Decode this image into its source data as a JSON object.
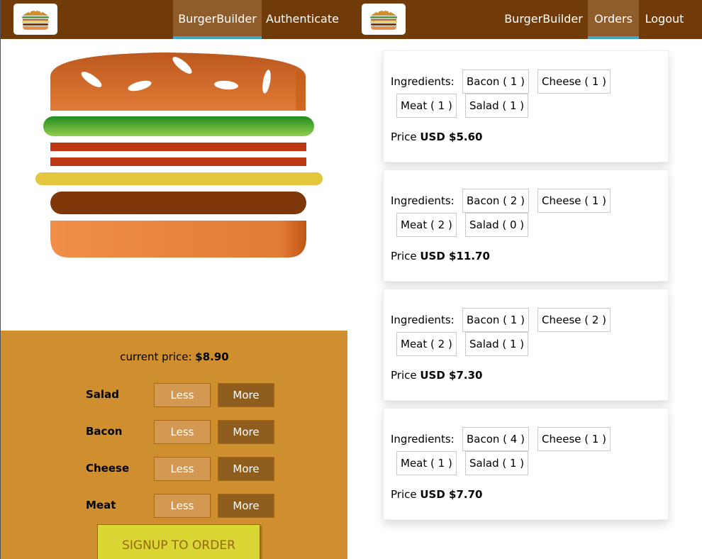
{
  "left_app": {
    "nav": {
      "brand": "BurgerBuilder",
      "auth": "Authenticate"
    },
    "current_price_label": "current price:",
    "current_price_value": "$8.90",
    "controls": [
      {
        "label": "Salad",
        "less": "Less",
        "more": "More"
      },
      {
        "label": "Bacon",
        "less": "Less",
        "more": "More"
      },
      {
        "label": "Cheese",
        "less": "Less",
        "more": "More"
      },
      {
        "label": "Meat",
        "less": "Less",
        "more": "More"
      }
    ],
    "signup_label": "SIGNUP TO ORDER",
    "burger_layers": [
      "bread-top",
      "salad",
      "bacon",
      "bacon",
      "cheese",
      "meat",
      "bread-bottom"
    ]
  },
  "right_app": {
    "nav": {
      "brand": "BurgerBuilder",
      "orders": "Orders",
      "logout": "Logout"
    },
    "ingredients_label": "Ingredients:",
    "price_label": "Price",
    "orders": [
      {
        "bacon": "Bacon ( 1 )",
        "cheese": "Cheese ( 1 )",
        "meat": "Meat ( 1 )",
        "salad": "Salad ( 1 )",
        "price": "USD $5.60"
      },
      {
        "bacon": "Bacon ( 2 )",
        "cheese": "Cheese ( 1 )",
        "meat": "Meat ( 2 )",
        "salad": "Salad ( 0 )",
        "price": "USD $11.70"
      },
      {
        "bacon": "Bacon ( 1 )",
        "cheese": "Cheese ( 2 )",
        "meat": "Meat ( 2 )",
        "salad": "Salad ( 1 )",
        "price": "USD $7.30"
      },
      {
        "bacon": "Bacon ( 4 )",
        "cheese": "Cheese ( 1 )",
        "meat": "Meat ( 1 )",
        "salad": "Salad ( 1 )",
        "price": "USD $7.70"
      }
    ]
  },
  "colors": {
    "toolbar": "#703B09",
    "nav_active": "#8F5C2C",
    "nav_active_underline": "#40A4C8",
    "controls_bg": "#CF8F2E",
    "more_button": "#8F5E1E",
    "less_button": "#D39952",
    "signup_bg": "#DAD735",
    "signup_text": "#966909"
  }
}
